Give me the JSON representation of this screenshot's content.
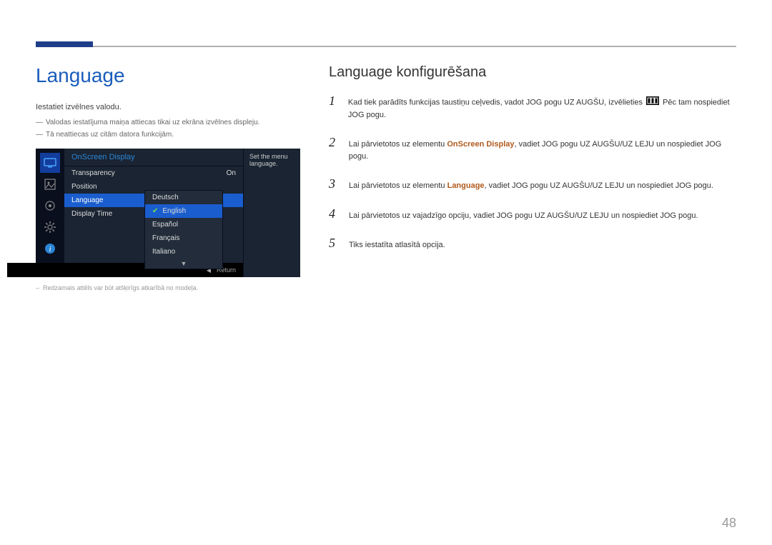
{
  "page_number": "48",
  "left": {
    "title": "Language",
    "intro": "Iestatiet izvēlnes valodu.",
    "notes": [
      "Valodas iestatījuma maiņa attiecas tikai uz ekrāna izvēlnes displeju.",
      "Tā neattiecas uz citām datora funkcijām."
    ],
    "footnote": "Redzamais attēls var būt atšķirīgs atkarībā no modeļa."
  },
  "osd": {
    "header": "OnScreen Display",
    "rows": [
      {
        "label": "Transparency",
        "value": "On"
      },
      {
        "label": "Position",
        "value": ""
      },
      {
        "label": "Language",
        "value": "",
        "selected": true
      },
      {
        "label": "Display Time",
        "value": ""
      }
    ],
    "submenu": [
      {
        "label": "Deutsch"
      },
      {
        "label": "English",
        "selected": true
      },
      {
        "label": "Español"
      },
      {
        "label": "Français"
      },
      {
        "label": "Italiano"
      }
    ],
    "help": "Set the menu language.",
    "return_label": "Return"
  },
  "right": {
    "title": "Language konfigurēšana",
    "steps": [
      {
        "n": "1",
        "pre": "Kad tiek parādīts funkcijas taustiņu ceļvedis, vadot JOG pogu UZ AUGŠU, izvēlieties ",
        "post": " Pēc tam nospiediet JOG pogu."
      },
      {
        "n": "2",
        "pre": "Lai pārvietotos uz elementu ",
        "bold": "OnScreen Display",
        "post": ", vadiet JOG pogu UZ AUGŠU/UZ LEJU un nospiediet JOG pogu."
      },
      {
        "n": "3",
        "pre": "Lai pārvietotos uz elementu ",
        "bold": "Language",
        "post": ", vadiet JOG pogu UZ AUGŠU/UZ LEJU un nospiediet JOG pogu."
      },
      {
        "n": "4",
        "text": "Lai pārvietotos uz vajadzīgo opciju, vadiet JOG pogu UZ AUGŠU/UZ LEJU un nospiediet JOG pogu."
      },
      {
        "n": "5",
        "text": "Tiks iestatīta atlasītā opcija."
      }
    ]
  }
}
